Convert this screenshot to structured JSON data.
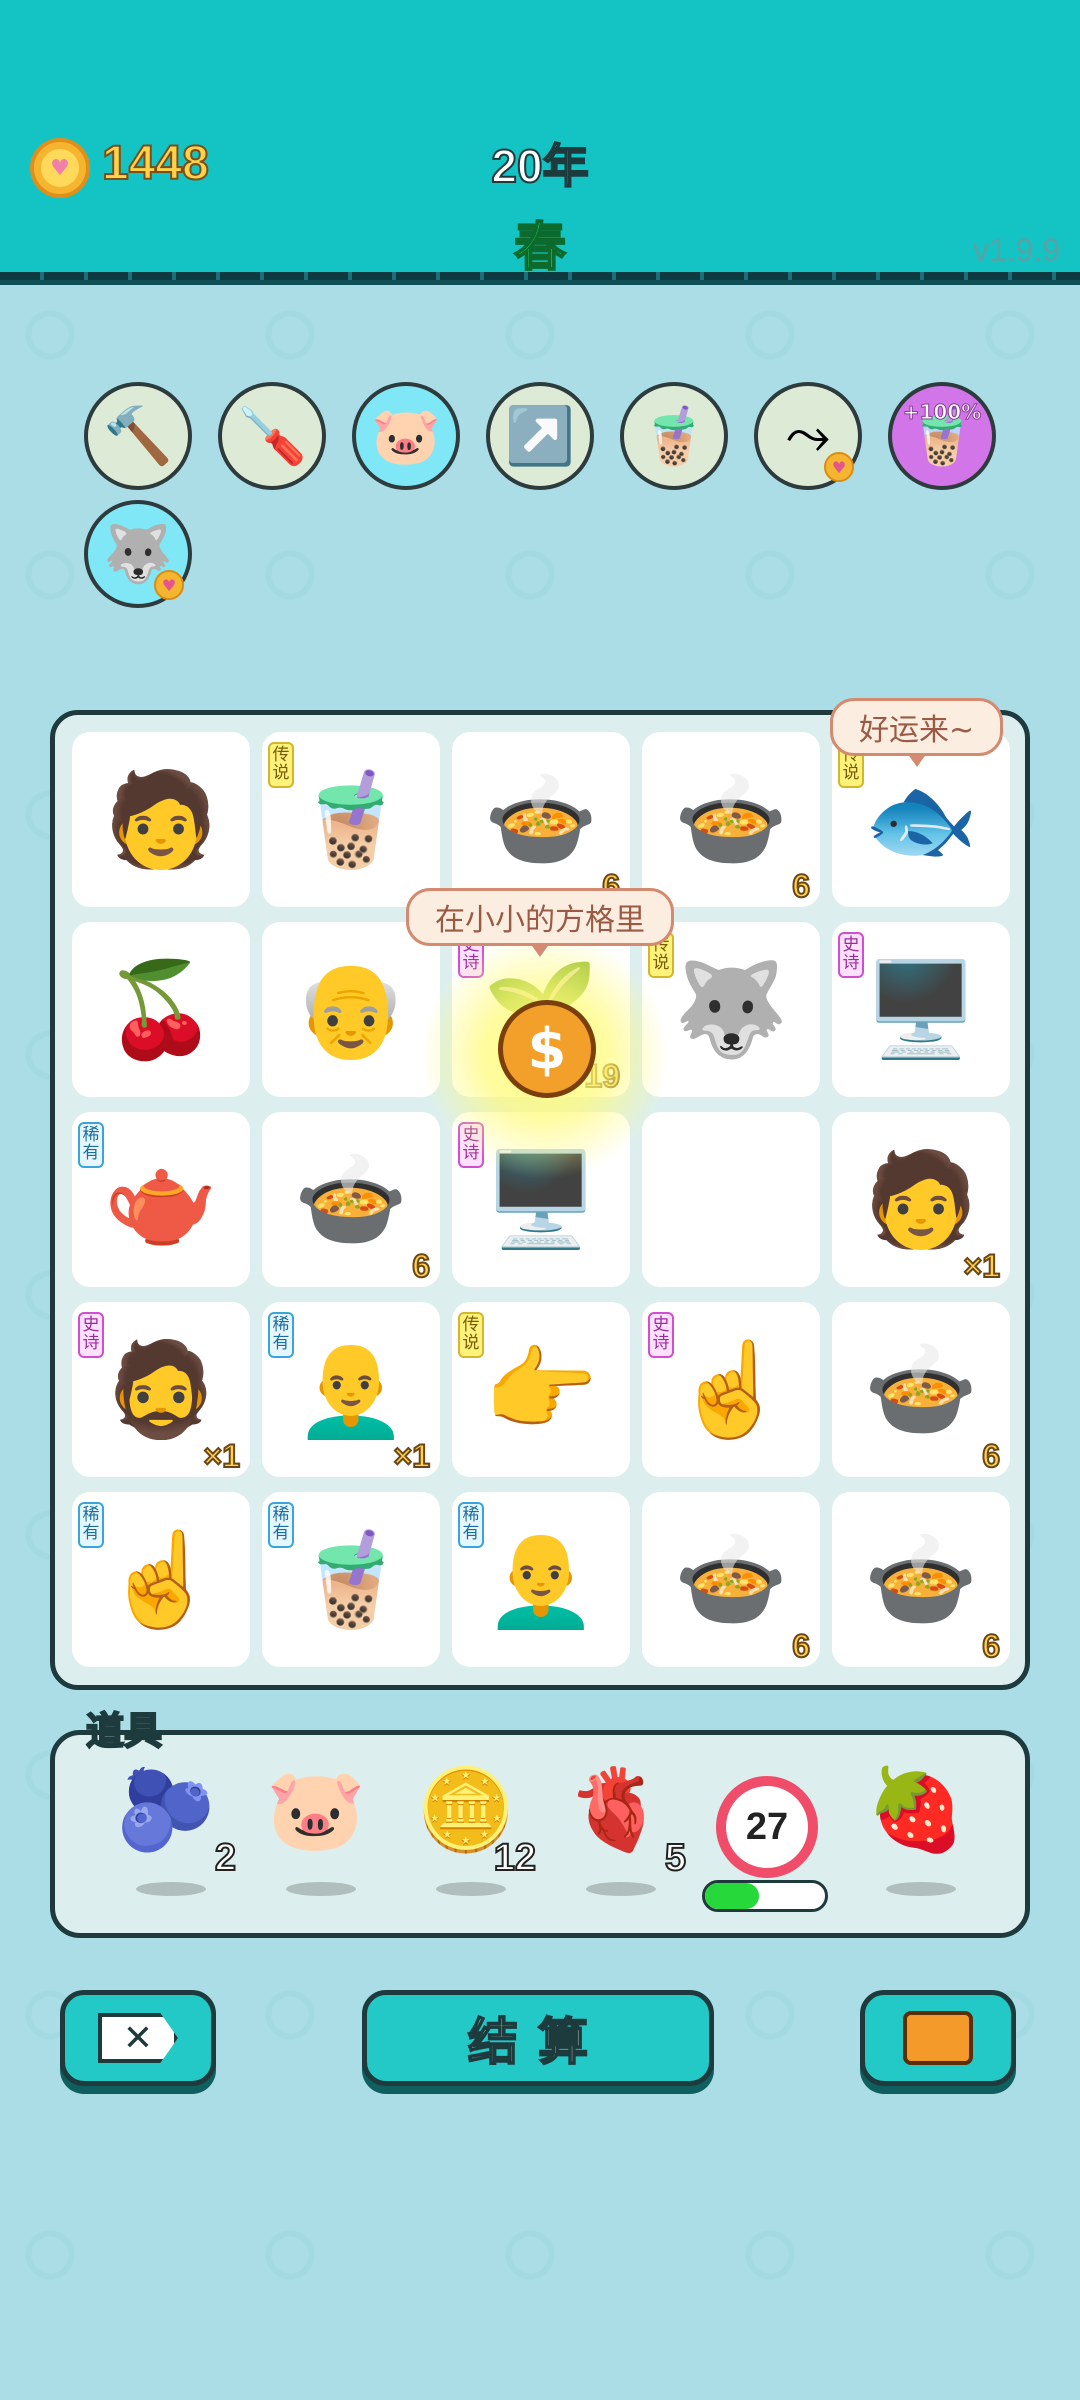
{
  "header": {
    "coins": "1448",
    "year": "20年",
    "season": "春",
    "version": "v1.9.9"
  },
  "relics": [
    {
      "name": "hammer",
      "icon": "🔨",
      "tag": ""
    },
    {
      "name": "screwdriver",
      "icon": "🪛",
      "tag": ""
    },
    {
      "name": "piggy-bank",
      "icon": "🐷",
      "tag": ""
    },
    {
      "name": "arrow-card",
      "icon": "↗️",
      "tag": ""
    },
    {
      "name": "milk-tea",
      "icon": "🧋",
      "tag": ""
    },
    {
      "name": "next-arrow",
      "icon": "⤳",
      "tag": ""
    },
    {
      "name": "milk-tea-bonus",
      "icon": "🧋",
      "tag": "+100%"
    },
    {
      "name": "husky",
      "icon": "🐺",
      "tag": ""
    }
  ],
  "board": {
    "bubble_luck": "好运来~",
    "bubble_song": "在小小的方格里",
    "cells": [
      {
        "icon": "🧑",
        "rarity": "",
        "count": ""
      },
      {
        "icon": "🧋",
        "rarity": "传说",
        "count": ""
      },
      {
        "icon": "🍲",
        "rarity": "",
        "count": "6"
      },
      {
        "icon": "🍲",
        "rarity": "",
        "count": "6"
      },
      {
        "icon": "🐟",
        "rarity": "传说",
        "count": ""
      },
      {
        "icon": "🍒",
        "rarity": "",
        "count": ""
      },
      {
        "icon": "👴",
        "rarity": "",
        "count": ""
      },
      {
        "icon": "🌱",
        "rarity": "史诗",
        "count": "19"
      },
      {
        "icon": "🐺",
        "rarity": "传说",
        "count": ""
      },
      {
        "icon": "🖥️",
        "rarity": "史诗",
        "count": ""
      },
      {
        "icon": "🫖",
        "rarity": "稀有",
        "count": ""
      },
      {
        "icon": "🍲",
        "rarity": "",
        "count": "6"
      },
      {
        "icon": "🖥️",
        "rarity": "史诗",
        "count": ""
      },
      {
        "icon": "",
        "rarity": "",
        "count": ""
      },
      {
        "icon": "🧑",
        "rarity": "",
        "count": "×1"
      },
      {
        "icon": "🧔",
        "rarity": "史诗",
        "count": "×1"
      },
      {
        "icon": "👨‍🦲",
        "rarity": "稀有",
        "count": "×1"
      },
      {
        "icon": "👉",
        "rarity": "传说",
        "count": ""
      },
      {
        "icon": "☝️",
        "rarity": "史诗",
        "count": ""
      },
      {
        "icon": "🍲",
        "rarity": "",
        "count": "6"
      },
      {
        "icon": "☝️",
        "rarity": "稀有",
        "count": ""
      },
      {
        "icon": "🧋",
        "rarity": "稀有",
        "count": ""
      },
      {
        "icon": "👨‍🦲",
        "rarity": "稀有",
        "count": ""
      },
      {
        "icon": "🍲",
        "rarity": "",
        "count": "6"
      },
      {
        "icon": "🍲",
        "rarity": "",
        "count": "6"
      }
    ]
  },
  "items": {
    "title": "道具",
    "list": [
      {
        "name": "blueberry",
        "icon": "🫐",
        "count": "2"
      },
      {
        "name": "piggy-bank",
        "icon": "🐷",
        "count": ""
      },
      {
        "name": "coin",
        "icon": "🪙",
        "count": "12"
      },
      {
        "name": "liver",
        "icon": "🫀",
        "count": "5"
      },
      {
        "name": "lychee",
        "icon": "🍓",
        "count": ""
      }
    ],
    "timer": "27",
    "timer_progress": 0.45
  },
  "buttons": {
    "settle": "结算"
  },
  "colors": {
    "header_bg": "#14c3c3",
    "page_bg": "#aadde6",
    "coin_text": "#ffd24a",
    "season_text": "#2ee36a",
    "legend_tag": "#fff27a",
    "epic_tag": "#d04fd0",
    "rare_tag": "#3aa5db"
  }
}
